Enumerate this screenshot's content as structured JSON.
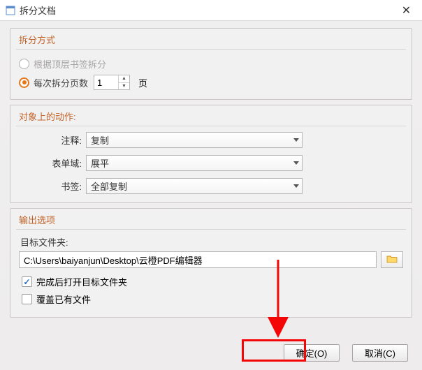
{
  "window": {
    "title": "拆分文档",
    "close_icon": "✕"
  },
  "split": {
    "section_title": "拆分方式",
    "by_bookmark_label": "根据顶层书签拆分",
    "by_pages_label": "每次拆分页数",
    "by_pages_value": "1",
    "by_pages_unit": "页"
  },
  "actions": {
    "section_title": "对象上的动作:",
    "annot_label": "注释:",
    "annot_value": "复制",
    "form_label": "表单域:",
    "form_value": "展平",
    "bookmark_label": "书签:",
    "bookmark_value": "全部复制"
  },
  "output": {
    "section_title": "输出选项",
    "dest_label": "目标文件夹:",
    "dest_value": "C:\\Users\\baiyanjun\\Desktop\\云橙PDF编辑器",
    "open_after_label": "完成后打开目标文件夹",
    "overwrite_label": "覆盖已有文件"
  },
  "buttons": {
    "ok": "确定(O)",
    "cancel": "取消(C)"
  }
}
